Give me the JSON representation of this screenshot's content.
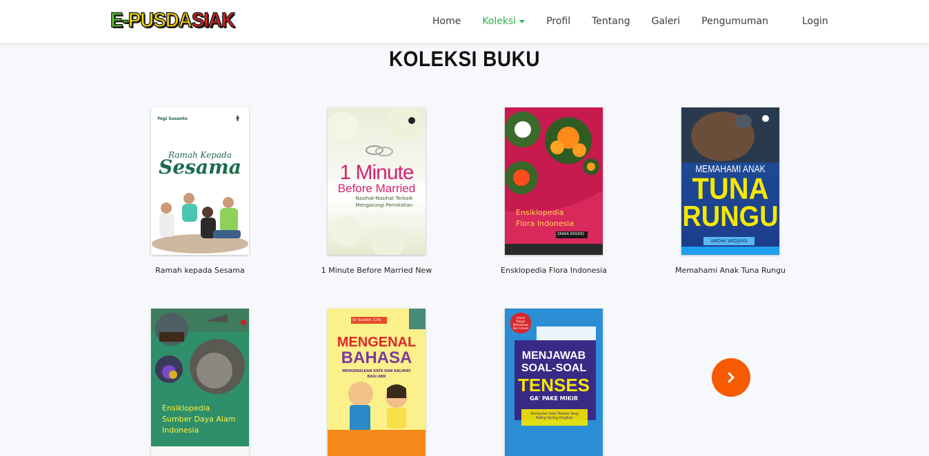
{
  "logo": {
    "text": "E-PUSDASIAK",
    "parts": [
      "E-",
      "PUS",
      "DA",
      "SIAK"
    ]
  },
  "nav": {
    "items": [
      {
        "label": "Home"
      },
      {
        "label": "Koleksi"
      },
      {
        "label": "Profil"
      },
      {
        "label": "Tentang"
      },
      {
        "label": "Galeri"
      },
      {
        "label": "Pengumuman"
      }
    ],
    "login": "Login"
  },
  "section": {
    "title": "KOLEKSI BUKU"
  },
  "books": [
    {
      "title": "Ramah kepada Sesama",
      "cover_author": "Yogi Susanto",
      "cover_line1": "Ramah Kepada",
      "cover_line2": "Sesama"
    },
    {
      "title": "1 Minute Before Married New",
      "cover_line1": "1 Minute",
      "cover_line2": "Before Married",
      "cover_line3": "Nasihat-Nasihat Terbaik",
      "cover_line4": "Mengarungi Pernikahan"
    },
    {
      "title": "Ensklopedia Flora Indonesia",
      "cover_line1": "Ensiklopedia",
      "cover_line2": "Flora Indonesia",
      "cover_author": "ZAKKA ASSIDIQ"
    },
    {
      "title": "Memahami Anak Tuna Rungu",
      "cover_line1": "MEMAHAMI ANAK",
      "cover_line2": "TUNA",
      "cover_line3": "RUNGU",
      "cover_author": "ARDHI WIDJAYA"
    },
    {
      "title": "",
      "cover_line1": "Ensiklopedia",
      "cover_line2": "Sumber Daya Alam",
      "cover_line3": "Indonesia"
    },
    {
      "title": "",
      "cover_author": "Sri Sulastri, S.Pd",
      "cover_line1": "MENGENAL",
      "cover_line2": "BAHASA",
      "cover_line3": "MENGENALKAN KATA DAN KALIMAT",
      "cover_line4": "BAGI ABK"
    },
    {
      "title": "",
      "cover_tag": "Untuk Pelajar Mahasiswa Dan Umum",
      "cover_line1": "MENJAWAB",
      "cover_line2": "SOAL-SOAL",
      "cover_line3": "TENSES",
      "cover_line4": "GA' PAKE MIKIR",
      "cover_line5": "Kumpulan Soal Tenses Yang Paling Sering Diujikan"
    }
  ],
  "colors": {
    "accent": "#2bb24c",
    "next_button": "#f75a00"
  },
  "next_button": {
    "icon": "chevron-right-icon"
  }
}
